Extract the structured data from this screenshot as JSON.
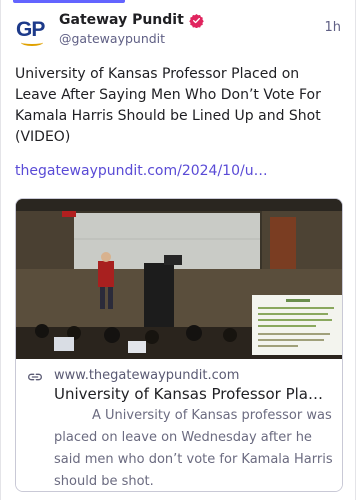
{
  "post": {
    "display_name": "Gateway Pundit",
    "handle": "@gatewaypundit",
    "time": "1h",
    "avatar_text": "GP",
    "text": "University of Kansas Professor Placed on Leave After Saying Men Who Don’t Vote For Kamala Harris Should be Lined Up and Shot (VIDEO)",
    "link_text": "thegatewaypundit.com/2024/10/u…"
  },
  "card": {
    "domain": "www.thegatewaypundit.com",
    "title": "University of Kansas Professor Place…",
    "description": "A University of Kansas professor was placed on leave on Wednesday after he said men who don’t vote for Kamala Harris should be shot."
  },
  "colors": {
    "accent": "#6364ff",
    "link": "#5a4bd6",
    "verified": "#e0245e"
  },
  "icons": {
    "verified": "verified-badge-icon",
    "card_link": "link-chain-icon"
  }
}
